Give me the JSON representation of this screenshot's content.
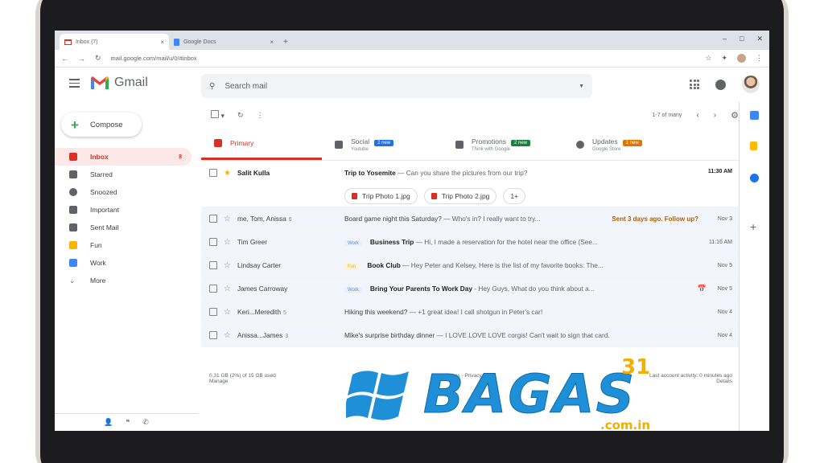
{
  "browser": {
    "tabs": [
      {
        "title": "Inbox (7)",
        "close": "×"
      },
      {
        "title": "Google Docs",
        "close": "×"
      }
    ],
    "new_tab": "+",
    "url": "mail.google.com/mail/u/0/#inbox"
  },
  "gmail": {
    "logo_text": "Gmail",
    "search_placeholder": "Search mail",
    "compose_label": "Compose"
  },
  "sidebar": {
    "items": [
      {
        "label": "Inbox",
        "count": "8",
        "icon": "inbox-icon",
        "color": "#d93025"
      },
      {
        "label": "Starred",
        "icon": "star-icon",
        "color": "#5f6368"
      },
      {
        "label": "Snoozed",
        "icon": "clock-icon",
        "color": "#5f6368"
      },
      {
        "label": "Important",
        "icon": "important-icon",
        "color": "#5f6368"
      },
      {
        "label": "Sent Mail",
        "icon": "send-icon",
        "color": "#5f6368"
      },
      {
        "label": "Fun",
        "icon": "label-icon",
        "color": "#f4b400"
      },
      {
        "label": "Work",
        "icon": "label-icon",
        "color": "#4285f4"
      },
      {
        "label": "More",
        "icon": "chevron-down-icon",
        "color": "#5f6368"
      }
    ]
  },
  "toolbar": {
    "pagination": "1-7 of many"
  },
  "category_tabs": [
    {
      "label": "Primary",
      "sub": "",
      "badge": "",
      "badge_color": ""
    },
    {
      "label": "Social",
      "sub": "Youtube",
      "badge": "2 new",
      "badge_color": "#1a73e8"
    },
    {
      "label": "Promotions",
      "sub": "Think with Google",
      "badge": "2 new",
      "badge_color": "#188038"
    },
    {
      "label": "Updates",
      "sub": "Google Store",
      "badge": "1 new",
      "badge_color": "#e37400"
    }
  ],
  "emails": [
    {
      "sender": "Salit Kulla",
      "count": "",
      "label": "",
      "subject": "Trip to Yosemite",
      "snippet": " — Can you share the pictures from our trip?",
      "date": "11:30 AM",
      "unread": true,
      "starred": true
    },
    {
      "sender": "me, Tom, Anissa",
      "count": "6",
      "label": "",
      "subject": "Board game night this Saturday?",
      "snippet": " — Who's in? I really want to try...",
      "date": "Nov 3",
      "unread": false,
      "starred": false,
      "followup": "Sent 3 days ago. Follow up?"
    },
    {
      "sender": "Tim Greer",
      "count": "",
      "label": "Work",
      "subject": "Business Trip",
      "snippet": " — Hi, I made a reservation for the hotel near the office (See...",
      "date": "11:16 AM",
      "unread": false,
      "starred": false
    },
    {
      "sender": "Lindsay Carter",
      "count": "",
      "label": "Fun",
      "subject": "Book Club",
      "snippet": " — Hey Peter and Kelsey, Here is the list of my favorite books: The...",
      "date": "Nov 5",
      "unread": false,
      "starred": false
    },
    {
      "sender": "James Carroway",
      "count": "",
      "label": "Work",
      "subject": "Bring Your Parents To Work Day",
      "snippet": " - Hey Guys, What do you think about a...",
      "date": "Nov 5",
      "unread": false,
      "starred": false
    },
    {
      "sender": "Keri...Meredith",
      "count": "5",
      "label": "",
      "subject": "Hiking this weekend?",
      "snippet": " — +1 great idea! I call shotgun in Peter's car!",
      "date": "Nov 4",
      "unread": false,
      "starred": false
    },
    {
      "sender": "Anissa...James",
      "count": "3",
      "label": "",
      "subject": "Mike's surprise birthday dinner",
      "snippet": " — I LOVE LOVE LOVE corgis! Can't wait to sign that card.",
      "date": "Nov 4",
      "unread": false,
      "starred": false
    }
  ],
  "attachments": [
    "Trip Photo 1.jpg",
    "Trip Photo 2.jpg",
    "1+"
  ],
  "footer": {
    "storage": "0.31 GB (2%) of 15 GB used",
    "manage": "Manage",
    "terms": "Terms · Privacy",
    "activity": "Last account activity: 0 minutes ago",
    "details": "Details"
  },
  "watermark": {
    "brand": "BAGAS",
    "number": "31",
    "domain": ".com.in"
  }
}
